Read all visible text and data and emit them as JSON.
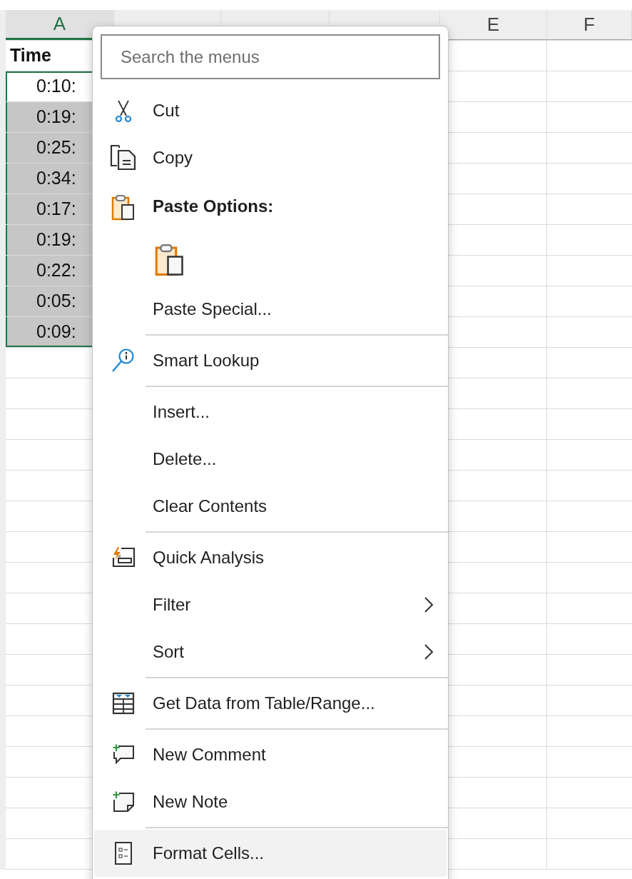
{
  "sheet": {
    "columns": [
      {
        "label": "A",
        "selected": true
      },
      {
        "selected": false
      },
      {
        "selected": false
      },
      {
        "selected": false
      },
      {
        "label": "E",
        "selected": false
      },
      {
        "label": "F",
        "selected": false
      }
    ],
    "header_cell": "Time",
    "cells": [
      {
        "value": "0:10:",
        "selected": true,
        "active": true
      },
      {
        "value": "0:19:",
        "selected": true,
        "active": false
      },
      {
        "value": "0:25:",
        "selected": true,
        "active": false
      },
      {
        "value": "0:34:",
        "selected": true,
        "active": false
      },
      {
        "value": "0:17:",
        "selected": true,
        "active": false
      },
      {
        "value": "0:19:",
        "selected": true,
        "active": false
      },
      {
        "value": "0:22:",
        "selected": true,
        "active": false
      },
      {
        "value": "0:05:",
        "selected": true,
        "active": false
      },
      {
        "value": "0:09:",
        "selected": true,
        "active": false
      }
    ]
  },
  "context_menu": {
    "search": {
      "placeholder": "Search the menus"
    },
    "items": [
      {
        "kind": "item",
        "label": "Cut",
        "selected": false
      },
      {
        "kind": "item",
        "label": "Copy",
        "selected": false
      },
      {
        "kind": "header",
        "label": "Paste Options:"
      },
      {
        "kind": "paste_icons"
      },
      {
        "kind": "item",
        "label": "Paste Special...",
        "selected": false
      },
      {
        "kind": "separator"
      },
      {
        "kind": "item",
        "label": "Smart Lookup",
        "selected": false
      },
      {
        "kind": "separator"
      },
      {
        "kind": "item",
        "label": "Insert...",
        "selected": false
      },
      {
        "kind": "item",
        "label": "Delete...",
        "selected": false
      },
      {
        "kind": "item",
        "label": "Clear Contents",
        "selected": false
      },
      {
        "kind": "separator"
      },
      {
        "kind": "item",
        "label": "Quick Analysis",
        "selected": false
      },
      {
        "kind": "item",
        "label": "Filter",
        "submenu": true,
        "selected": false
      },
      {
        "kind": "item",
        "label": "Sort",
        "submenu": true,
        "selected": false
      },
      {
        "kind": "separator"
      },
      {
        "kind": "item",
        "label": "Get Data from Table/Range...",
        "selected": false
      },
      {
        "kind": "separator"
      },
      {
        "kind": "item",
        "label": "New Comment",
        "selected": false
      },
      {
        "kind": "item",
        "label": "New Note",
        "selected": false
      },
      {
        "kind": "separator"
      },
      {
        "kind": "item",
        "label": "Format Cells...",
        "selected": true
      }
    ]
  }
}
